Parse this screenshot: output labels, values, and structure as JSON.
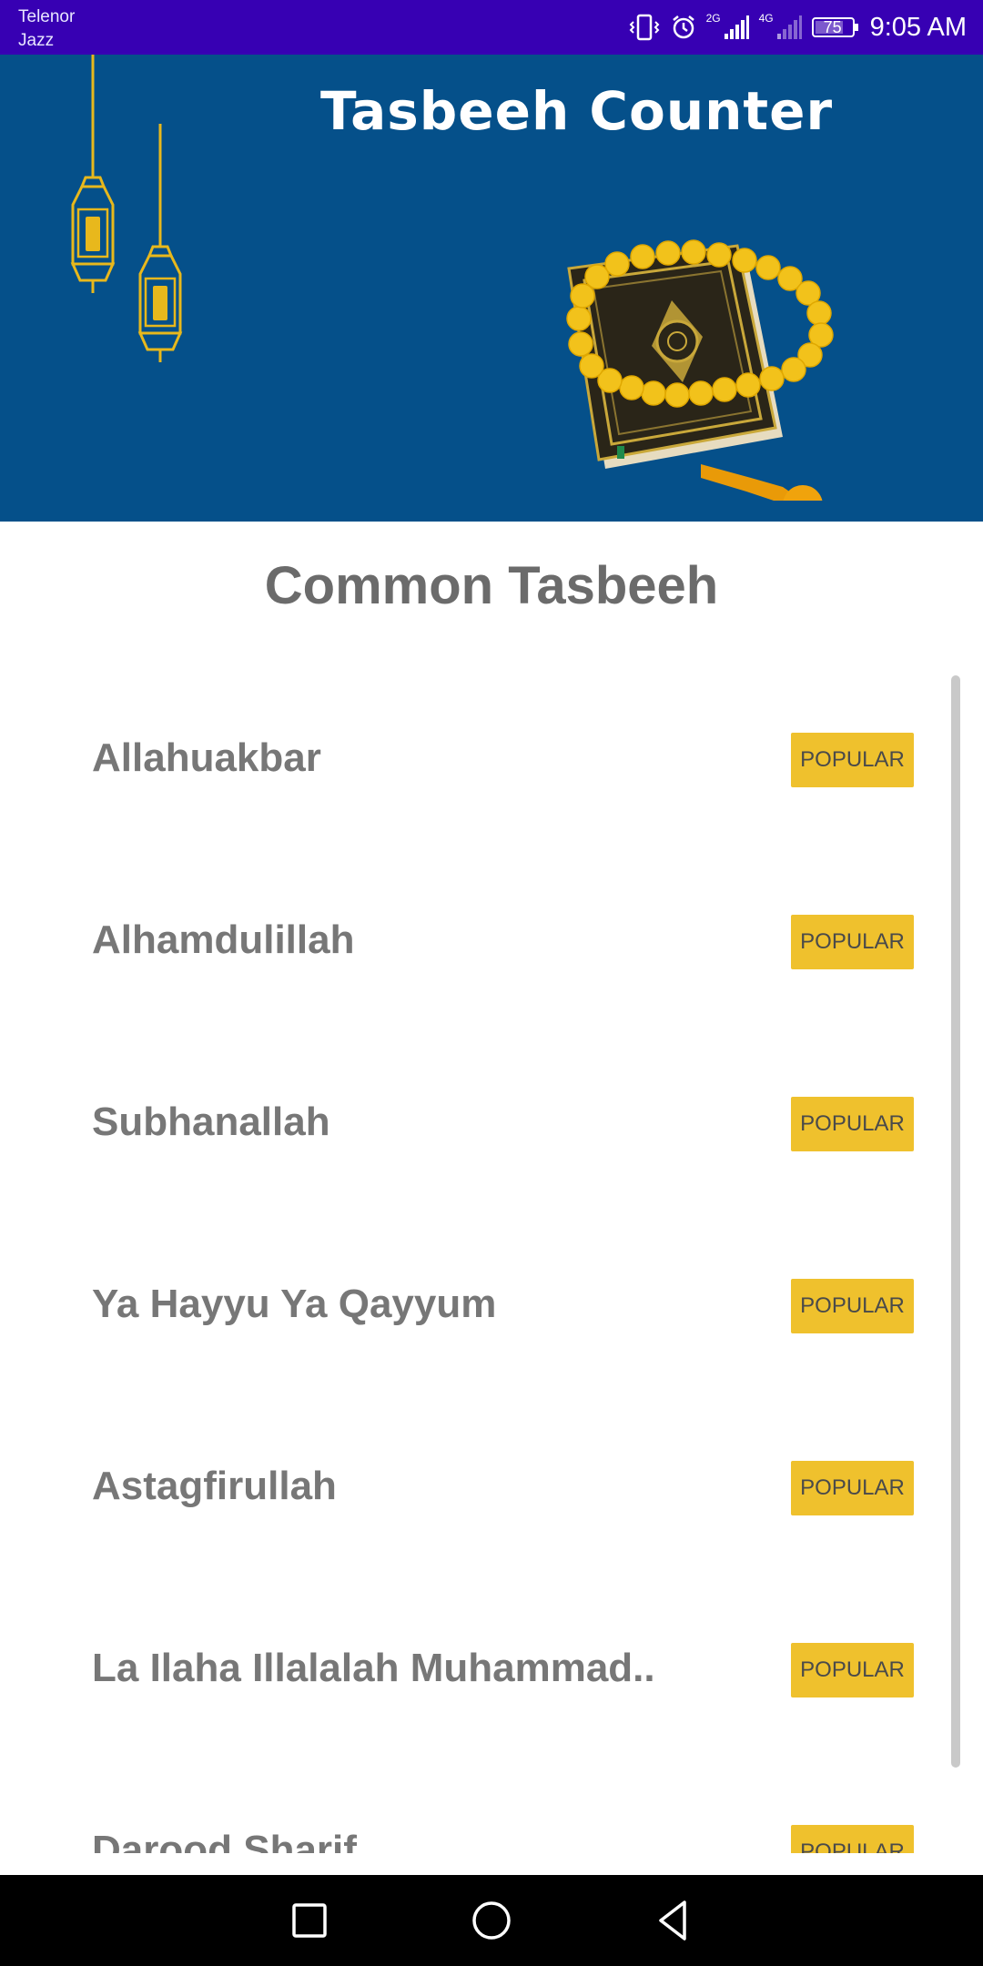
{
  "status_bar": {
    "carrier_line1": "Telenor",
    "carrier_line2": "Jazz",
    "network_2g": "2G",
    "network_4g": "4G",
    "battery": "75",
    "time": "9:05 AM"
  },
  "header": {
    "title": "Tasbeeh Counter"
  },
  "section": {
    "title": "Common Tasbeeh"
  },
  "list": {
    "items": [
      {
        "label": "Allahuakbar",
        "badge": "POPULAR"
      },
      {
        "label": "Alhamdulillah",
        "badge": "POPULAR"
      },
      {
        "label": "Subhanallah",
        "badge": "POPULAR"
      },
      {
        "label": "Ya Hayyu Ya Qayyum",
        "badge": "POPULAR"
      },
      {
        "label": "Astagfirullah",
        "badge": "POPULAR"
      },
      {
        "label": "La Ilaha Illalalah Muhammad..",
        "badge": "POPULAR"
      },
      {
        "label": "Darood Sharif",
        "badge": "POPULAR"
      }
    ]
  },
  "nav": {
    "icons": [
      "recent-apps-icon",
      "home-icon",
      "back-icon"
    ]
  },
  "colors": {
    "status_bar": "#3700b3",
    "header_bg": "#05508a",
    "badge_bg": "#efc12d",
    "gold": "#e8b81c"
  }
}
